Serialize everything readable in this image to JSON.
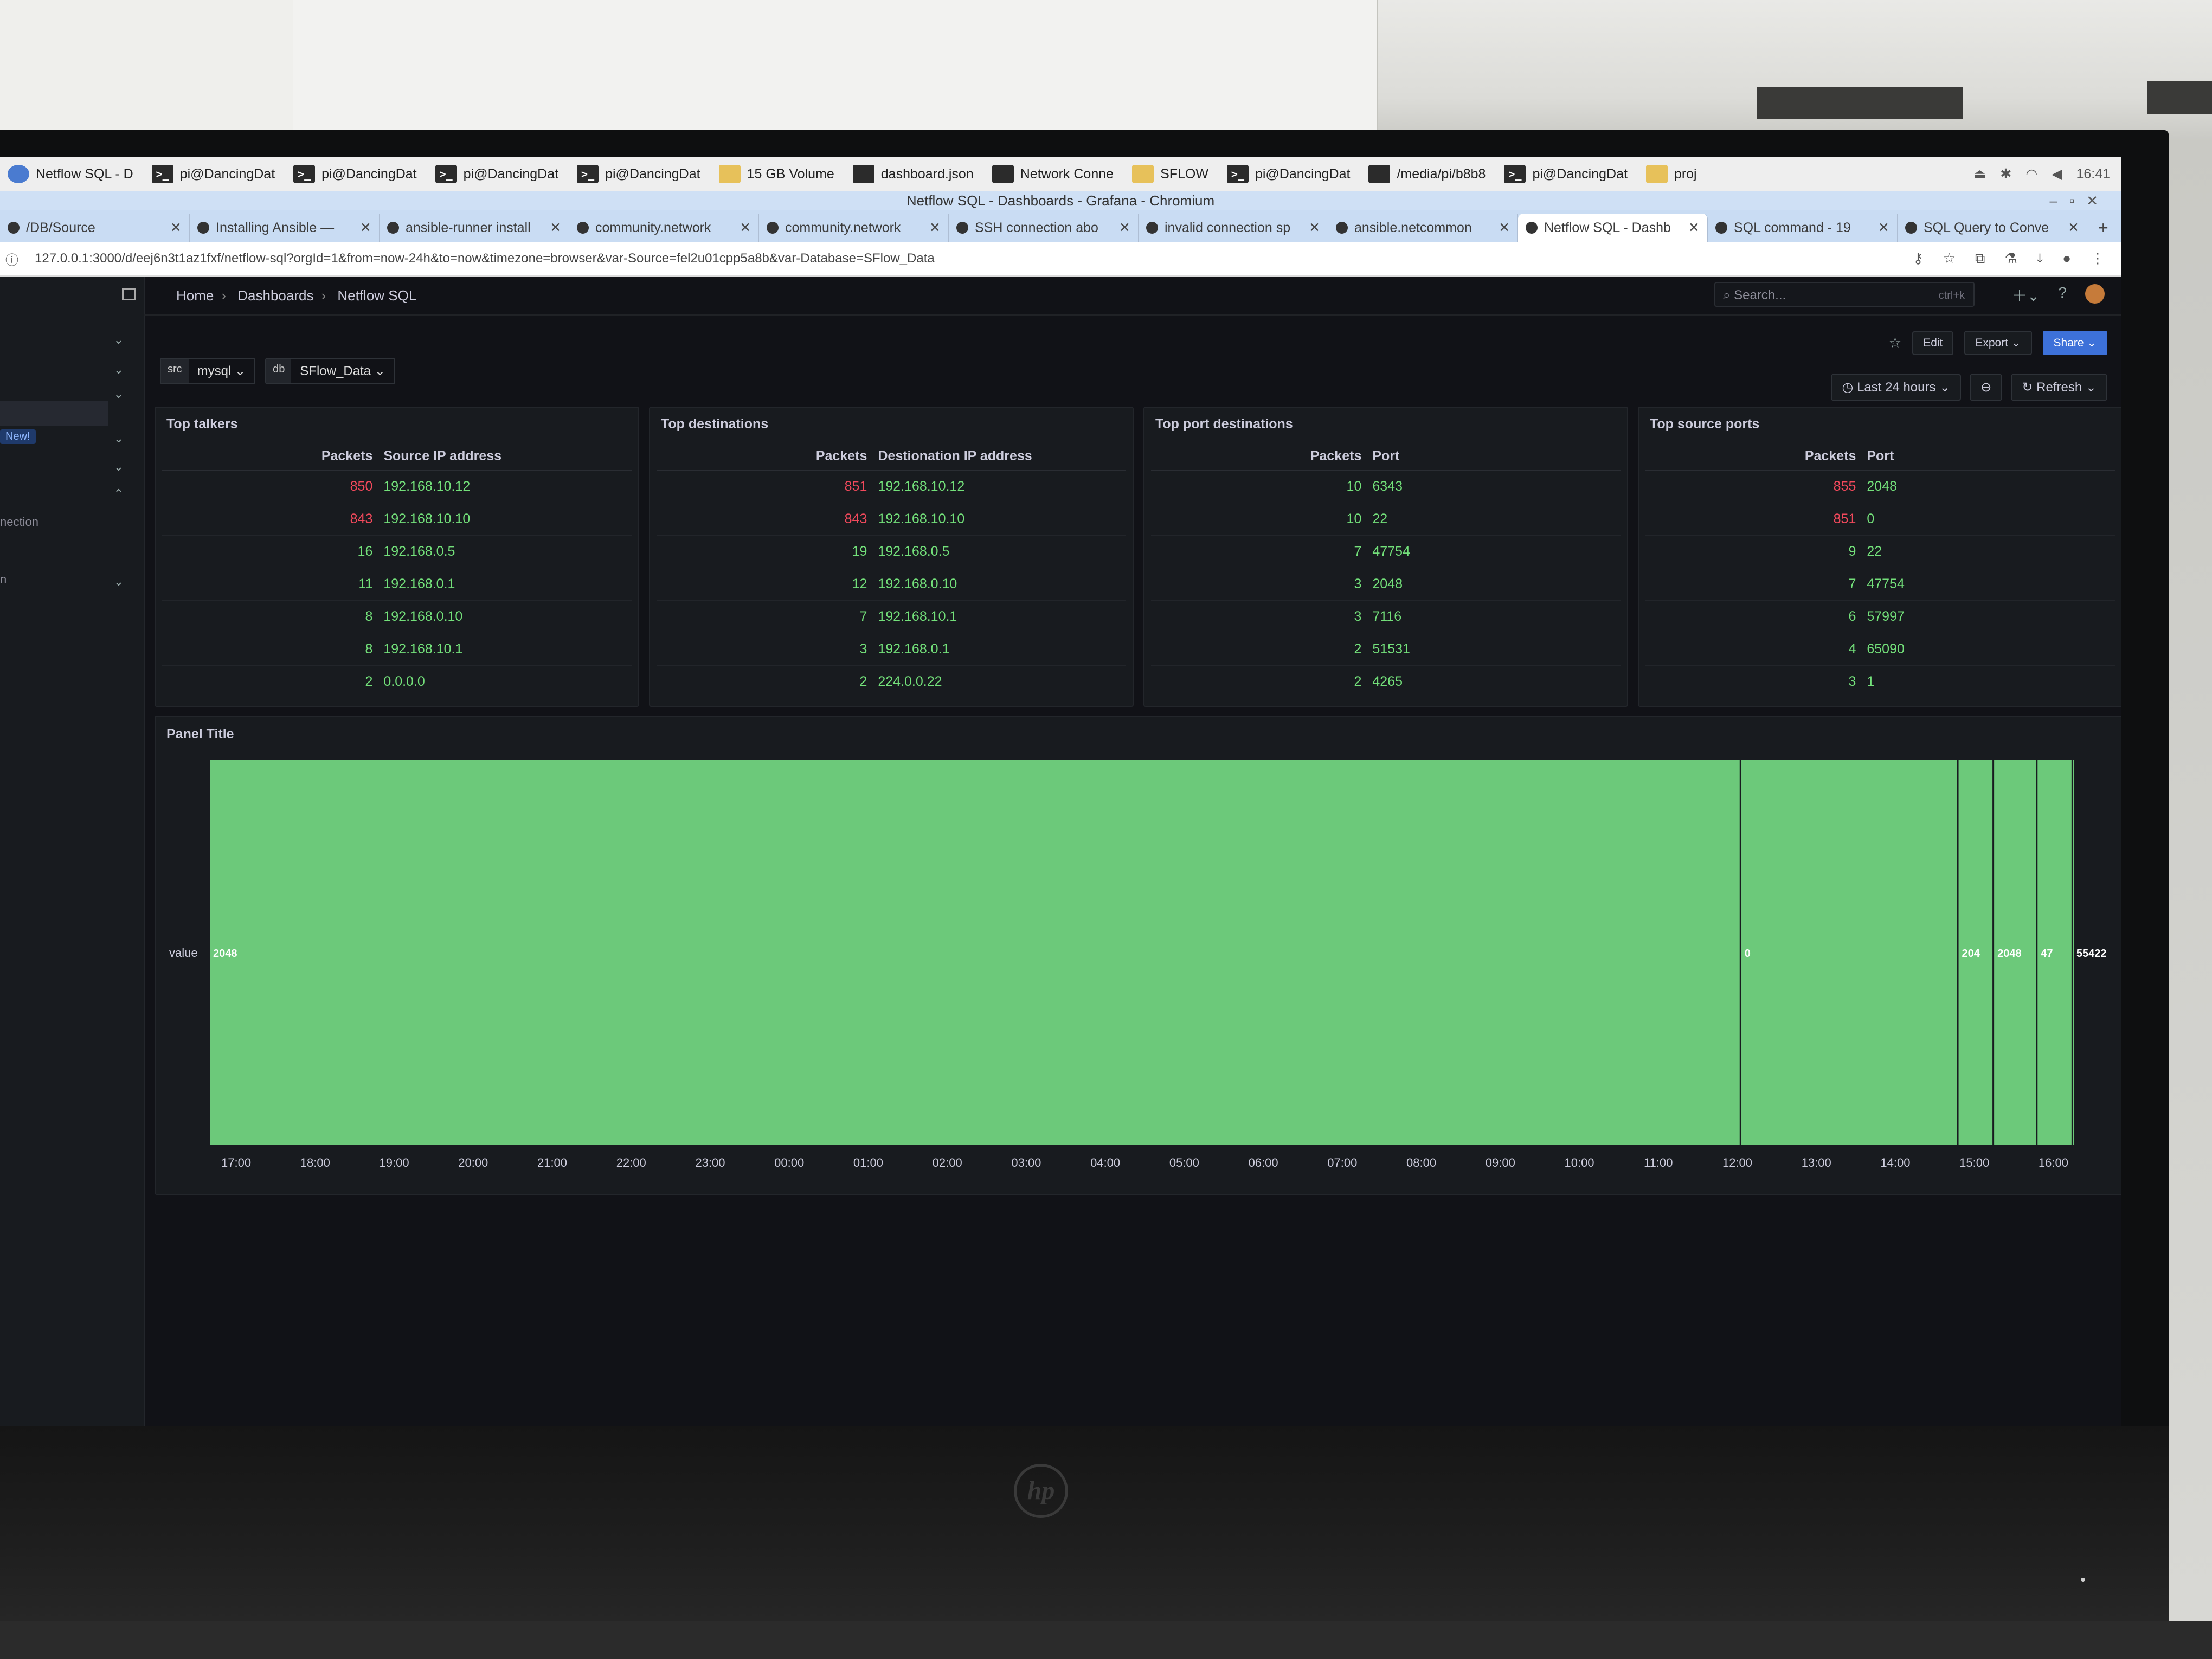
{
  "taskbar": {
    "items": [
      {
        "icon": "chrome-icon",
        "label": "Netflow SQL - D"
      },
      {
        "icon": "terminal-icon",
        "label": "pi@DancingDat"
      },
      {
        "icon": "terminal-icon",
        "label": "pi@DancingDat"
      },
      {
        "icon": "terminal-icon",
        "label": "pi@DancingDat"
      },
      {
        "icon": "terminal-icon",
        "label": "pi@DancingDat"
      },
      {
        "icon": "folder-icon",
        "label": "15 GB Volume"
      },
      {
        "icon": "editor-icon",
        "label": "dashboard.json"
      },
      {
        "icon": "network-icon",
        "label": "Network Conne"
      },
      {
        "icon": "folder-icon",
        "label": "SFLOW"
      },
      {
        "icon": "terminal-icon",
        "label": "pi@DancingDat"
      },
      {
        "icon": "pencil-icon",
        "label": "/media/pi/b8b8"
      },
      {
        "icon": "terminal-icon",
        "label": "pi@DancingDat"
      },
      {
        "icon": "folder-icon",
        "label": "proj"
      }
    ],
    "clock": "16:41"
  },
  "window": {
    "title": "Netflow SQL - Dashboards - Grafana - Chromium"
  },
  "tabs": [
    {
      "label": "/DB/Source",
      "active": false
    },
    {
      "label": "Installing Ansible —",
      "active": false
    },
    {
      "label": "ansible-runner install",
      "active": false
    },
    {
      "label": "community.network",
      "active": false
    },
    {
      "label": "community.network",
      "active": false
    },
    {
      "label": "SSH connection abo",
      "active": false
    },
    {
      "label": "invalid connection sp",
      "active": false
    },
    {
      "label": "ansible.netcommon",
      "active": false
    },
    {
      "label": "Netflow SQL - Dashb",
      "active": true
    },
    {
      "label": "SQL command - 19",
      "active": false
    },
    {
      "label": "SQL Query to Conve",
      "active": false
    }
  ],
  "address_bar": {
    "url": "127.0.0.1:3000/d/eej6n3t1az1fxf/netflow-sql?orgId=1&from=now-24h&to=now&timezone=browser&var-Source=fel2u01cpp5a8b&var-Database=SFlow_Data"
  },
  "sidebar": {
    "new_badge": "New!",
    "partial_item": "nection",
    "partial_item2": "n"
  },
  "breadcrumb": [
    "Home",
    "Dashboards",
    "Netflow SQL"
  ],
  "search": {
    "placeholder": "Search...",
    "shortcut": "ctrl+k"
  },
  "toolbar": {
    "edit": "Edit",
    "export": "Export",
    "share": "Share"
  },
  "variables": [
    {
      "key": "src",
      "value": "mysql"
    },
    {
      "key": "db",
      "value": "SFlow_Data"
    }
  ],
  "time_range": {
    "label": "Last 24 hours",
    "refresh": "Refresh"
  },
  "colors": {
    "high": "#f2495c",
    "normal": "#73e07a",
    "bar": "#6cc97a",
    "accent": "#3d71d9"
  },
  "panels": [
    {
      "title": "Top talkers",
      "headers": [
        "Packets",
        "Source IP address"
      ],
      "rows": [
        {
          "packets": "850",
          "value": "192.168.10.12",
          "level": "high"
        },
        {
          "packets": "843",
          "value": "192.168.10.10",
          "level": "high"
        },
        {
          "packets": "16",
          "value": "192.168.0.5",
          "level": "normal"
        },
        {
          "packets": "11",
          "value": "192.168.0.1",
          "level": "normal"
        },
        {
          "packets": "8",
          "value": "192.168.0.10",
          "level": "normal"
        },
        {
          "packets": "8",
          "value": "192.168.10.1",
          "level": "normal"
        },
        {
          "packets": "2",
          "value": "0.0.0.0",
          "level": "normal"
        }
      ]
    },
    {
      "title": "Top destinations",
      "headers": [
        "Packets",
        "Destionation IP address"
      ],
      "rows": [
        {
          "packets": "851",
          "value": "192.168.10.12",
          "level": "high"
        },
        {
          "packets": "843",
          "value": "192.168.10.10",
          "level": "high"
        },
        {
          "packets": "19",
          "value": "192.168.0.5",
          "level": "normal"
        },
        {
          "packets": "12",
          "value": "192.168.0.10",
          "level": "normal"
        },
        {
          "packets": "7",
          "value": "192.168.10.1",
          "level": "normal"
        },
        {
          "packets": "3",
          "value": "192.168.0.1",
          "level": "normal"
        },
        {
          "packets": "2",
          "value": "224.0.0.22",
          "level": "normal"
        }
      ]
    },
    {
      "title": "Top port destinations",
      "headers": [
        "Packets",
        "Port"
      ],
      "rows": [
        {
          "packets": "10",
          "value": "6343",
          "level": "normal"
        },
        {
          "packets": "10",
          "value": "22",
          "level": "normal"
        },
        {
          "packets": "7",
          "value": "47754",
          "level": "normal"
        },
        {
          "packets": "3",
          "value": "2048",
          "level": "normal"
        },
        {
          "packets": "3",
          "value": "7116",
          "level": "normal"
        },
        {
          "packets": "2",
          "value": "51531",
          "level": "normal"
        },
        {
          "packets": "2",
          "value": "4265",
          "level": "normal"
        }
      ]
    },
    {
      "title": "Top source ports",
      "headers": [
        "Packets",
        "Port"
      ],
      "rows": [
        {
          "packets": "855",
          "value": "2048",
          "level": "high"
        },
        {
          "packets": "851",
          "value": "0",
          "level": "high"
        },
        {
          "packets": "9",
          "value": "22",
          "level": "normal"
        },
        {
          "packets": "7",
          "value": "47754",
          "level": "normal"
        },
        {
          "packets": "6",
          "value": "57997",
          "level": "normal"
        },
        {
          "packets": "4",
          "value": "65090",
          "level": "normal"
        },
        {
          "packets": "3",
          "value": "1",
          "level": "normal"
        }
      ]
    }
  ],
  "chart_data": {
    "type": "state-timeline",
    "title": "Panel Title",
    "row_label": "value",
    "x_ticks": [
      "17:00",
      "18:00",
      "19:00",
      "20:00",
      "21:00",
      "22:00",
      "23:00",
      "00:00",
      "01:00",
      "02:00",
      "03:00",
      "04:00",
      "05:00",
      "06:00",
      "07:00",
      "08:00",
      "09:00",
      "10:00",
      "11:00",
      "12:00",
      "13:00",
      "14:00",
      "15:00",
      "16:00"
    ],
    "x_range": [
      "16:40",
      "16:41"
    ],
    "segments": [
      {
        "start": "16:40",
        "end": "12:03",
        "value": "2048"
      },
      {
        "start": "12:03",
        "end": "14:48",
        "value": "0"
      },
      {
        "start": "14:48",
        "end": "15:15",
        "value": "204"
      },
      {
        "start": "15:15",
        "end": "15:48",
        "value": "2048"
      },
      {
        "start": "15:48",
        "end": "16:15",
        "value": "47"
      },
      {
        "start": "16:15",
        "end": "16:41",
        "value": "55422"
      }
    ]
  }
}
